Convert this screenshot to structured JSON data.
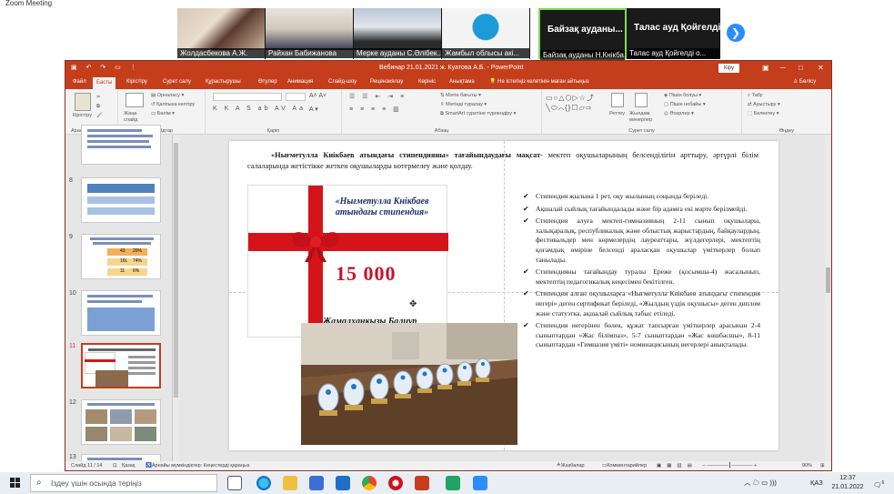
{
  "zoom": {
    "window_title": "Zoom Meeting",
    "tiles": [
      {
        "name": "Жолдасбекова А.Ж."
      },
      {
        "name": "Райхан Бабижанова"
      },
      {
        "name": "Мерке ауданы С.Әлібек..."
      },
      {
        "name": "Жамбыл облысы акі..."
      },
      {
        "name": "Байзақ ауданы Н.Кнікба...",
        "big": "Байзақ ауданы..."
      },
      {
        "name": "Талас ауд Қойгелді о...",
        "big": "Талас ауд Қойгелді..."
      }
    ],
    "next": "❯"
  },
  "ppt": {
    "title": "Вебинар 21.01.2021 ж. Куатова А.Б.  -  PowerPoint",
    "signin": "Кіру",
    "tabs": [
      "Файл",
      "Басты",
      "Кірістіру",
      "Сурет салу",
      "Құрастырушы",
      "Өтулер",
      "Анимация",
      "Слайд-шоу",
      "Рецензиялау",
      "Көрініс",
      "Анықтама"
    ],
    "active_tab": "Басты",
    "tell_me": "Не істегіңіз келетінін маған айтыңыз",
    "share": "Бөлісу",
    "ribbon": {
      "paste": "Кірістіру",
      "new_slide": "Жаңа слайд",
      "layout": "Орналасу",
      "reset": "Қалпына келтіру",
      "section": "Бөлім",
      "font_size": "",
      "align_text": "Мәтін бағыты",
      "align_text2": "Мәтінді туралау",
      "smartart": "SmartArt суретіне түрлендіру",
      "arrange": "Реттеу",
      "quick_styles": "Жылдам мәнерлер",
      "shape_fill": "Пішін бояуы",
      "shape_outline": "Пішін нобайы",
      "shape_effects": "Әсерлер",
      "find": "Табу",
      "replace": "Ауыстыру",
      "select": "Белектеу",
      "groups": [
        "Аралық сақтағыш",
        "Слайдтар",
        "Қаріп",
        "Абзац",
        "Сурет салу",
        "Өңдеу"
      ]
    },
    "thumb_numbers": [
      "8",
      "9",
      "10",
      "11",
      "12",
      "13"
    ],
    "thumb9": {
      "r1": "43",
      "r1b": "20%",
      "r2": "16L",
      "r2b": "74%",
      "r3": "11",
      "r3b": "6%"
    },
    "slide": {
      "heading_bold": "«Нығметулла Кнікбаев атындағы стипендияны» тағайындаудағы мақсат-",
      "heading_rest": " мектеп оқушыларының белсенділігін арттыру, әртүрлі білім салаларында жетістікке жеткен оқушыларды көтермелеу және қолдау.",
      "cert_title": "«Нығметулла Кнікбаев атындағы стипендия»",
      "cert_amount": "15 000",
      "cert_name": "Жамалханқызы Балиур",
      "bullets": [
        "Стипендия жылына 1 рет, оқу жылының соңында беріледі.",
        "Ақшалай сыйлық тағайындалады  және бір адамға екі мәрте берілмейді.",
        "Стипендия алуға мектеп-гимназияның 2-11 сынып оқушылары, халықаралық, республикалық және облыстық жарыстардың, байқаулардың, фестивальдер мен көрмелердің лауреаттары, жүлдегерлері, мектептің қоғамдық өміріне белсенді араласқан оқушылар үміткерлер болып танылады.",
        "Стипендияны тағайындау туралы Ереже (қосымша-4) жасалынып, мектептің педагогикалық кеңесімен бекітілген.",
        "Стипендия алған оқушыларға «Нығметулла Кнікбаев атындағы стипендия иегері» деген сертификат беріледі, «Жылдың үздік оқушысы» деген диплом және статуэтка, ақшалай сыйлық табыс етіледі.",
        "Стипендия иегерінен бөлек, құжат тапсырған үміткерлер арасынан 2-4 сыныптардан «Жас білімпаз», 5-7 сыныптардан «Жас көшбасшы», 8-11 сыныптардан «Гимназия үміті» номинацисының иегерлері анықталады."
      ]
    },
    "status": {
      "slide": "Слайд 11 / 14",
      "lang": "Қазақ",
      "access": "Арнайы мүмкіндіктер: Кеңестерді қараңыз",
      "notes": "Жазбалар",
      "comments": "Комментарийлер",
      "zoom": "90%"
    }
  },
  "taskbar": {
    "search_placeholder": "Іздеу үшін осында теріңіз",
    "lang": "ҚАЗ",
    "time": "12:37",
    "date": "21.01.2022",
    "notif": "6"
  },
  "colors": {
    "ppt_accent": "#c43e1c",
    "zoom_blue": "#2d8cff",
    "ribbon_red": "#d5141a"
  }
}
